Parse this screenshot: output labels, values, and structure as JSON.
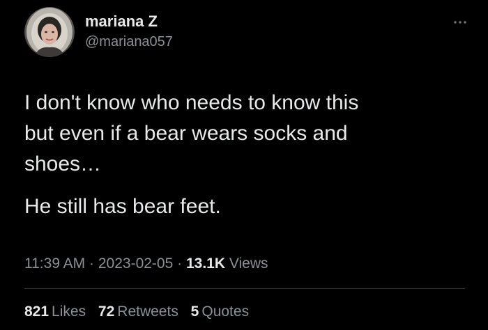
{
  "author": {
    "display_name": "mariana Z",
    "handle": "@mariana057"
  },
  "tweet": {
    "paragraphs": [
      "I don't know who needs to know this\nbut even if a bear wears socks and\nshoes…",
      "He still has bear feet."
    ],
    "time": "11:39 AM",
    "separator": "·",
    "date": "2023-02-05",
    "views_count": "13.1K",
    "views_label": "Views"
  },
  "stats": {
    "likes_count": "821",
    "likes_label": "Likes",
    "retweets_count": "72",
    "retweets_label": "Retweets",
    "quotes_count": "5",
    "quotes_label": "Quotes"
  },
  "icons": {
    "more": "more-horizontal-icon",
    "avatar": "profile-photo"
  },
  "colors": {
    "background": "#000000",
    "primary_text": "#e7e9ea",
    "secondary_text": "#8b9197",
    "divider": "#2f3336"
  }
}
